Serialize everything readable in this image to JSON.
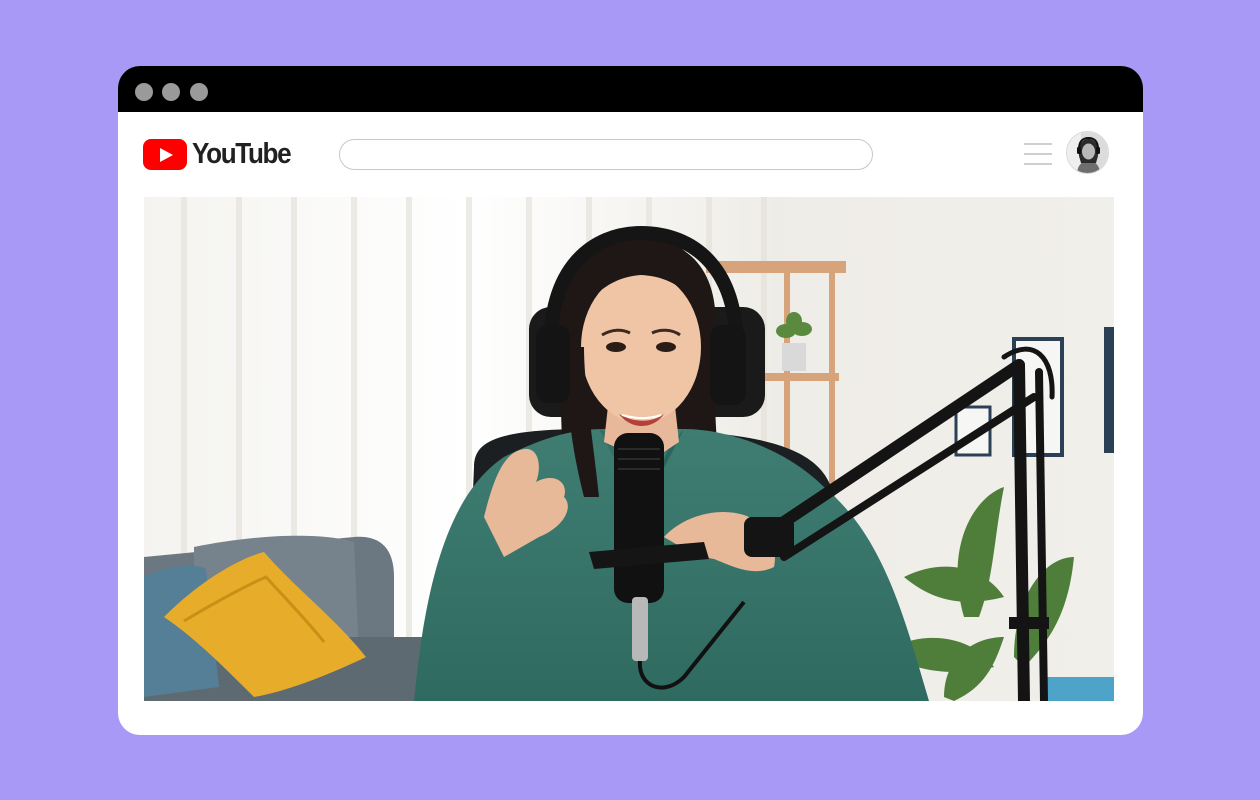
{
  "browser": {
    "window_controls": [
      "dot",
      "dot",
      "dot"
    ]
  },
  "header": {
    "logo_text": "YouTube",
    "search": {
      "value": "",
      "placeholder": ""
    },
    "menu_icon": "hamburger-menu-icon",
    "avatar": "user-avatar"
  },
  "main": {
    "video": "video-frame-podcaster-with-microphone"
  },
  "colors": {
    "background": "#a899f7",
    "titlebar": "#000000",
    "window": "#ffffff",
    "brand_red": "#ff0000",
    "window_dot": "#9a9a9a"
  }
}
